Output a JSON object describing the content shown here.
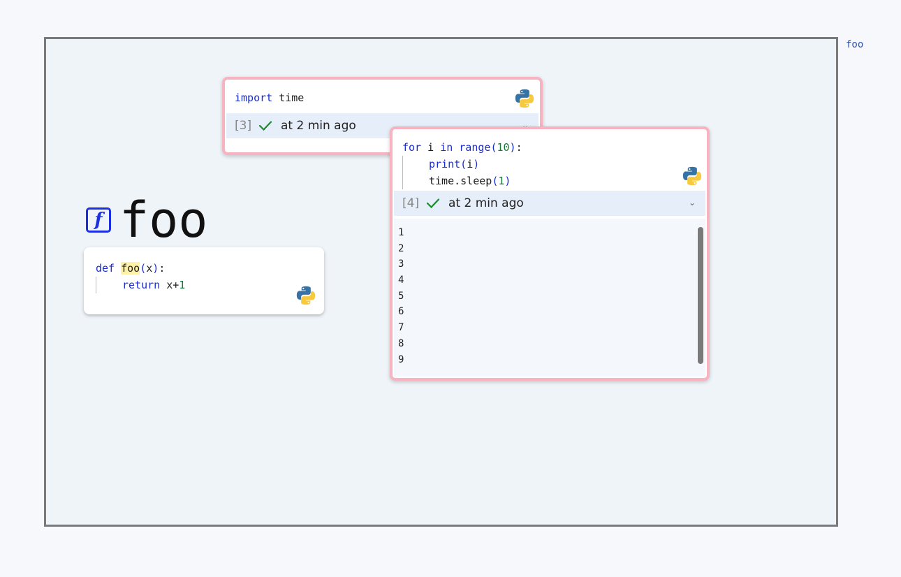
{
  "side_label": "foo",
  "function": {
    "badge": "f",
    "name": "foo",
    "code": {
      "kw_def": "def",
      "name": "foo",
      "open": "(",
      "arg": "x",
      "close": ")",
      "colon": ":",
      "kw_return": "return",
      "expr": "x+",
      "num": "1"
    }
  },
  "cell1": {
    "code": {
      "kw_import": "import",
      "module": "time"
    },
    "exec_count": "[3]",
    "status": "at 2 min ago",
    "chevron": "⌄"
  },
  "cell2": {
    "code": {
      "kw_for": "for",
      "var": "i",
      "kw_in": "in",
      "fn_range": "range",
      "open": "(",
      "num10": "10",
      "close": ")",
      "colon": ":",
      "fn_print": "print",
      "print_arg": "i",
      "sleep_call": "time.sleep",
      "num1": "1"
    },
    "exec_count": "[4]",
    "status": "at 2 min ago",
    "chevron": "⌄",
    "output_lines": [
      "1",
      "2",
      "3",
      "4",
      "5",
      "6",
      "7",
      "8",
      "9"
    ]
  },
  "colors": {
    "cell_border": "#f7b3c0",
    "keyword": "#1b2dd1",
    "number": "#137a3a",
    "badge": "#1c2fe0"
  },
  "icons": {
    "language": "python-logo-icon",
    "success": "checkmark-icon",
    "collapse": "chevron-down-icon",
    "function": "function-icon"
  }
}
